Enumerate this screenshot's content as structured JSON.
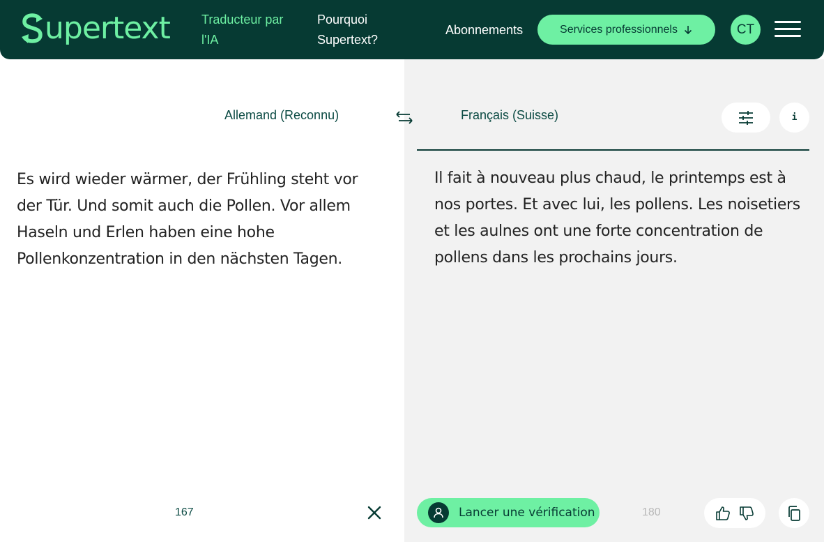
{
  "header": {
    "logo_text": "upertext",
    "tagline": "Traducteur par l'IA",
    "nav_why": "Pourquoi Supertext?",
    "nav_subscriptions": "Abonnements",
    "pro_services_label": "Services professionnels",
    "avatar_initials": "CT"
  },
  "languages": {
    "source": "Allemand (Reconnu)",
    "target": "Français (Suisse)"
  },
  "source_text": "Es wird wieder wärmer, der Frühling steht vor der Tür. Und somit auch die Pollen. Vor allem Haseln und Erlen haben eine hohe Pollenkonzentration in den nächsten Tagen.",
  "target_text": "Il fait à nouveau plus chaud, le printemps est à nos portes. Et avec lui, les pollens. Les noisetiers et les aulnes ont une forte concentration de pollens dans les prochains jours.",
  "footer": {
    "source_char_count": "167",
    "verify_label": "Lancer une vérification",
    "target_char_count": "180"
  },
  "colors": {
    "brand_dark": "#063a33",
    "brand_accent": "#6ef0a3",
    "panel_gray": "#f2f2f2"
  },
  "icons": {
    "swap": "swap-languages-icon",
    "settings": "sliders-icon",
    "info": "info-icon",
    "clear": "close-icon",
    "verify": "user-icon",
    "thumbs_up": "thumbs-up-icon",
    "thumbs_down": "thumbs-down-icon",
    "copy": "copy-icon",
    "menu": "hamburger-menu-icon",
    "arrow_down": "arrow-down-icon"
  }
}
